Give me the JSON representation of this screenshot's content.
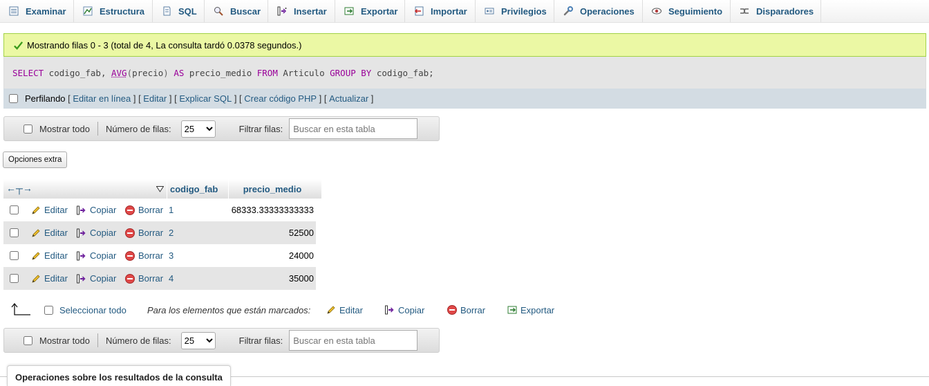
{
  "tabs": [
    {
      "label": "Examinar",
      "icon": "browse-icon"
    },
    {
      "label": "Estructura",
      "icon": "structure-icon"
    },
    {
      "label": "SQL",
      "icon": "sql-icon"
    },
    {
      "label": "Buscar",
      "icon": "search-icon"
    },
    {
      "label": "Insertar",
      "icon": "insert-icon"
    },
    {
      "label": "Exportar",
      "icon": "export-icon"
    },
    {
      "label": "Importar",
      "icon": "import-icon"
    },
    {
      "label": "Privilegios",
      "icon": "privileges-icon"
    },
    {
      "label": "Operaciones",
      "icon": "wrench-icon"
    },
    {
      "label": "Seguimiento",
      "icon": "eye-icon"
    },
    {
      "label": "Disparadores",
      "icon": "triggers-icon"
    }
  ],
  "message": {
    "text": "Mostrando filas 0 - 3 (total de 4, La consulta tardó 0.0378 segundos.)",
    "icon": "check-icon",
    "color": "#ebf8a4"
  },
  "sql": {
    "kw_select": "SELECT",
    "t1": " codigo_fab, ",
    "fn_avg": "AVG",
    "t2": "(",
    "t3": "precio",
    "t4": ")",
    "kw_as": " AS ",
    "t5": "precio_medio ",
    "kw_from": "FROM",
    "t6": " Articulo ",
    "kw_group": "GROUP BY",
    "t7": " codigo_fab;"
  },
  "tools": {
    "profiling": "Perfilando",
    "links": [
      "Editar en línea",
      "Editar",
      "Explicar SQL",
      "Crear código PHP",
      "Actualizar"
    ]
  },
  "nav": {
    "show_all": "Mostrar todo",
    "rows_label": "Número de filas:",
    "rows_value": "25",
    "filter_label": "Filtrar filas:",
    "filter_placeholder": "Buscar en esta tabla"
  },
  "extra_options": "Opciones extra",
  "table": {
    "columns": [
      "codigo_fab",
      "precio_medio"
    ],
    "actions": {
      "edit": "Editar",
      "copy": "Copiar",
      "delete": "Borrar"
    },
    "rows": [
      {
        "codigo_fab": "1",
        "precio_medio": "68333.33333333333"
      },
      {
        "codigo_fab": "2",
        "precio_medio": "52500"
      },
      {
        "codigo_fab": "3",
        "precio_medio": "24000"
      },
      {
        "codigo_fab": "4",
        "precio_medio": "35000"
      }
    ]
  },
  "bulk": {
    "select_all": "Seleccionar todo",
    "marked": "Para los elementos que están marcados:",
    "edit": "Editar",
    "copy": "Copiar",
    "delete": "Borrar",
    "export": "Exportar"
  },
  "operations_title": "Operaciones sobre los resultados de la consulta",
  "colors": {
    "link": "#235a81",
    "keyword": "#990099",
    "success_border": "#a2d246",
    "row_alt": "#e5e5e5"
  }
}
